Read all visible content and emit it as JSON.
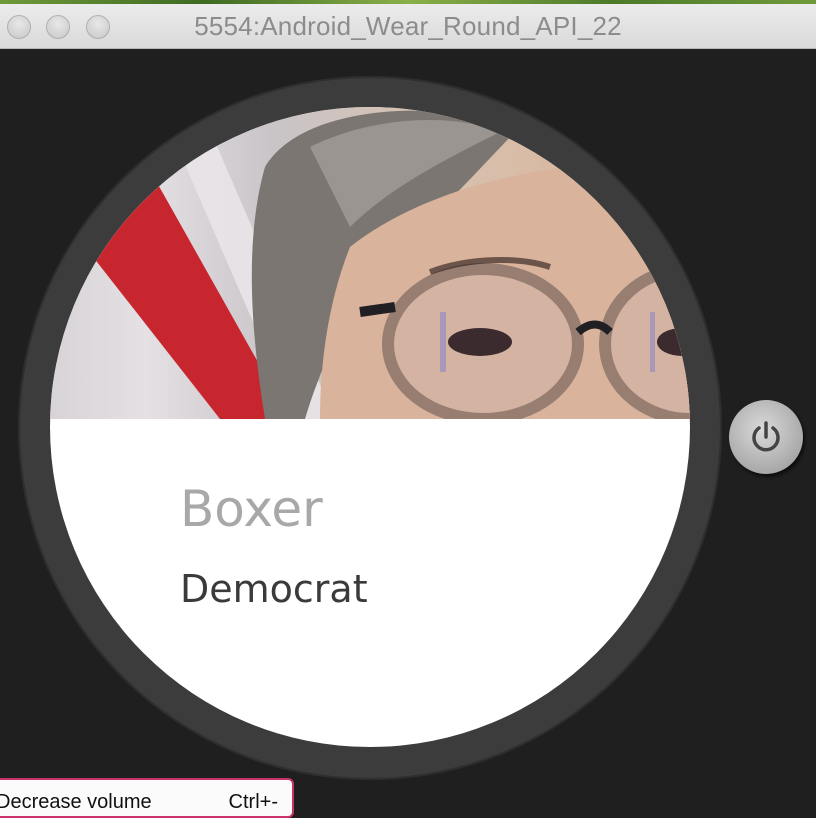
{
  "window": {
    "title": "5554:Android_Wear_Round_API_22"
  },
  "card": {
    "name": "Boxer",
    "party": "Democrat"
  },
  "tooltip": {
    "label": "Decrease volume",
    "shortcut": "Ctrl+-"
  },
  "icons": {
    "power": "power-icon",
    "close": "close-window-icon",
    "minimize": "minimize-window-icon",
    "zoom": "zoom-window-icon"
  },
  "colors": {
    "background": "#1f1f1f",
    "bezel": "#3c3c3c",
    "tooltip_border": "#c8336b"
  }
}
